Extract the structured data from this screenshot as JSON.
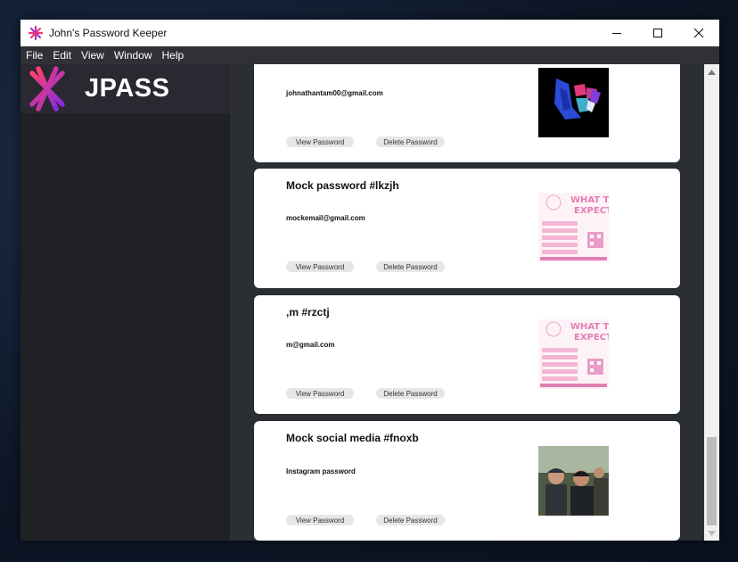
{
  "window": {
    "title": "John's Password Keeper",
    "controls": [
      "minimize-icon",
      "maximize-icon",
      "close-icon"
    ]
  },
  "menu": {
    "items": [
      {
        "label": "File"
      },
      {
        "label": "Edit"
      },
      {
        "label": "View"
      },
      {
        "label": "Window"
      },
      {
        "label": "Help"
      }
    ]
  },
  "sidebar": {
    "logo_text": "JPASS",
    "logo_colors": [
      "#e8357a",
      "#8b2be2"
    ]
  },
  "cards": [
    {
      "title": "",
      "detail": "johnathantam00@gmail.com",
      "view_label": "View Password",
      "delete_label": "Delete Password",
      "image": "abstract-colorful-logo"
    },
    {
      "title": "Mock password #lkzjh",
      "detail": "mockemail@gmail.com",
      "view_label": "View Password",
      "delete_label": "Delete Password",
      "image": "what-to-expect-poster",
      "poster_text": [
        "WHAT TO",
        "EXPECT"
      ]
    },
    {
      "title": ",m #rzctj",
      "detail": "m@gmail.com",
      "view_label": "View Password",
      "delete_label": "Delete Password",
      "image": "what-to-expect-poster",
      "poster_text": [
        "WHAT TO",
        "EXPECT"
      ]
    },
    {
      "title": "Mock social media #fnoxb",
      "detail": "Instagram password",
      "view_label": "View Password",
      "delete_label": "Delete Password",
      "image": "group-photo"
    }
  ],
  "colors": {
    "card_bg": "#ffffff",
    "main_bg": "#2b2e33",
    "sidebar_bg": "#1f2124",
    "button_bg": "#e6e6e6",
    "poster_pink": "#e27fb4"
  }
}
